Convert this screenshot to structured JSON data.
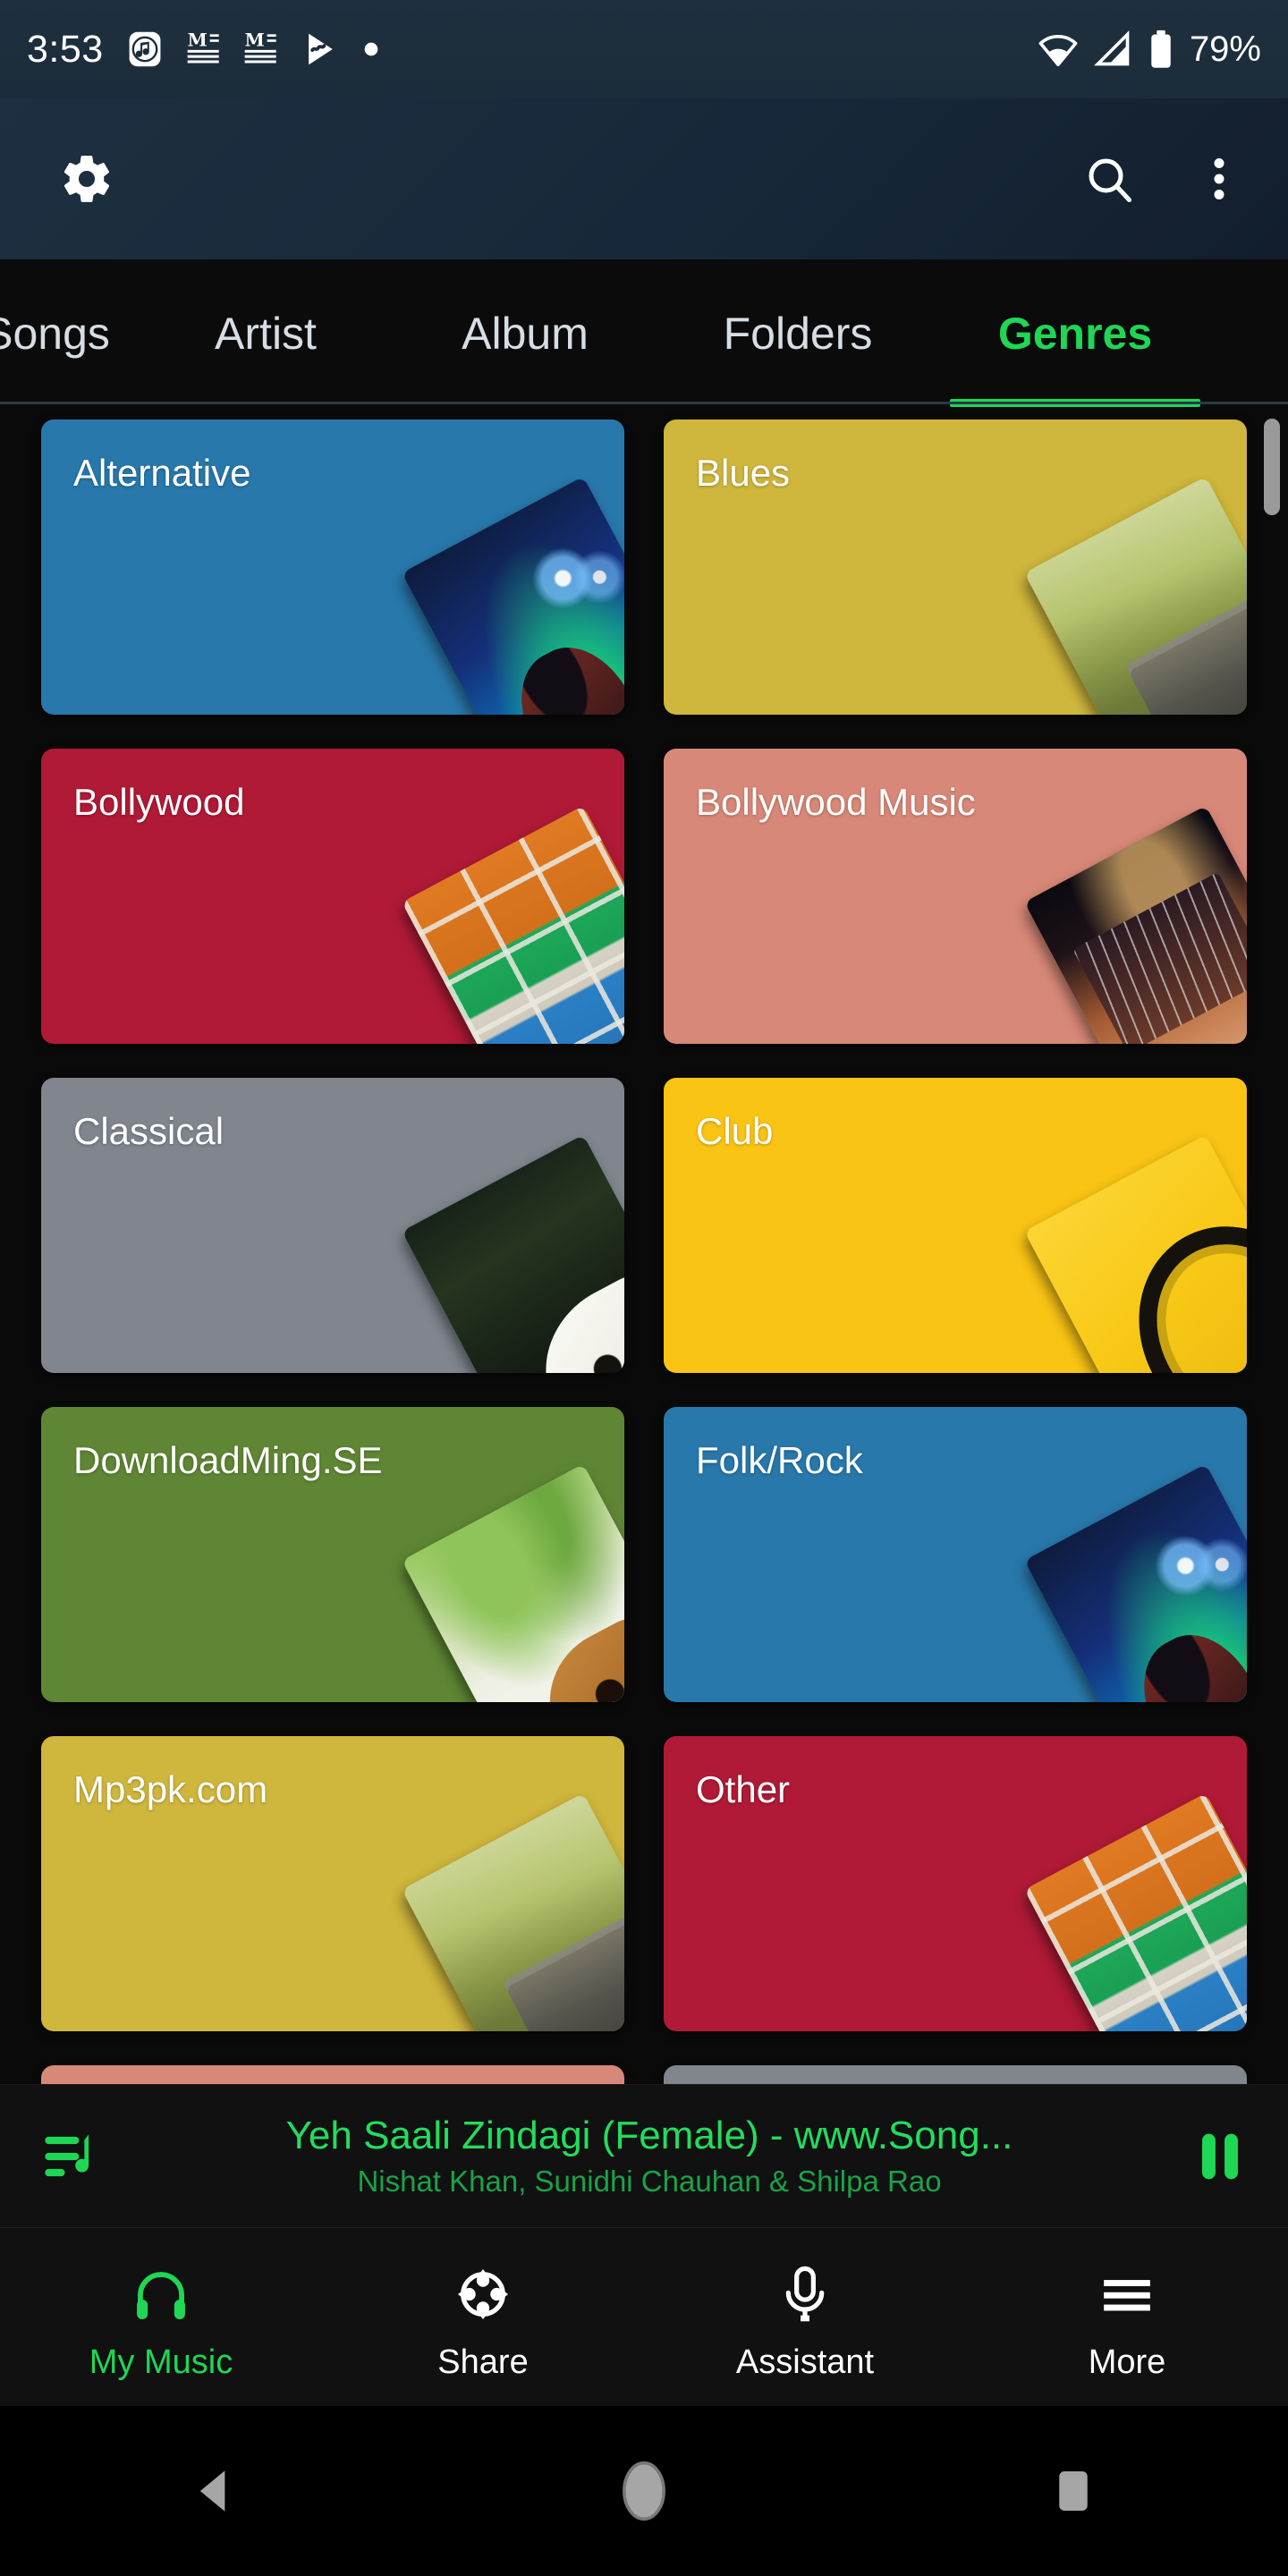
{
  "status_bar": {
    "time": "3:53",
    "battery_percent": "79%",
    "notification_icons": [
      "music-note-icon",
      "medium-icon",
      "medium-icon",
      "play-store-icon",
      "dot-icon"
    ],
    "system_icons": [
      "wifi-icon",
      "cell-signal-icon",
      "battery-icon"
    ]
  },
  "app_bar": {
    "settings_label": "Settings",
    "search_label": "Search",
    "overflow_label": "More options"
  },
  "tabs": {
    "items": [
      {
        "label": "Songs",
        "active": false
      },
      {
        "label": "Artist",
        "active": false
      },
      {
        "label": "Album",
        "active": false
      },
      {
        "label": "Folders",
        "active": false
      },
      {
        "label": "Genres",
        "active": true
      }
    ],
    "active_color": "#1fd655",
    "inactive_color": "#d6dde5"
  },
  "genres": {
    "cards": [
      {
        "label": "Alternative",
        "color": "#2878ab",
        "art": "art-stage"
      },
      {
        "label": "Blues",
        "color": "#cfb63c",
        "art": "art-field"
      },
      {
        "label": "Bollywood",
        "color": "#b01a36",
        "art": "art-brick"
      },
      {
        "label": "Bollywood Music",
        "color": "#d88878",
        "art": "art-studio"
      },
      {
        "label": "Classical",
        "color": "#80858e",
        "art": "art-guitar"
      },
      {
        "label": "Club",
        "color": "#f9c414",
        "art": "art-headphone"
      },
      {
        "label": "DownloadMing.SE",
        "color": "#5f8634",
        "art": "art-tree"
      },
      {
        "label": "Folk/Rock",
        "color": "#2878ab",
        "art": "art-stage"
      },
      {
        "label": "Mp3pk.com",
        "color": "#cfb63c",
        "art": "art-field"
      },
      {
        "label": "Other",
        "color": "#b01a36",
        "art": "art-brick"
      },
      {
        "label": "",
        "color": "#d88878",
        "art": "art-studio"
      },
      {
        "label": "",
        "color": "#80858e",
        "art": "art-guitar"
      }
    ]
  },
  "now_playing": {
    "title": "Yeh Saali Zindagi (Female) - www.Song...",
    "artist": "Nishat Khan, Sunidhi Chauhan & Shilpa Rao",
    "queue_icon": "playlist-icon",
    "transport_icon": "pause-icon",
    "accent_color": "#22dd5d"
  },
  "bottom_nav": {
    "items": [
      {
        "label": "My Music",
        "icon": "headphones-icon",
        "active": true
      },
      {
        "label": "Share",
        "icon": "share-icon",
        "active": false
      },
      {
        "label": "Assistant",
        "icon": "microphone-icon",
        "active": false
      },
      {
        "label": "More",
        "icon": "hamburger-icon",
        "active": false
      }
    ]
  },
  "android_nav": {
    "back": "back-button",
    "home": "home-button",
    "recents": "recents-button"
  }
}
